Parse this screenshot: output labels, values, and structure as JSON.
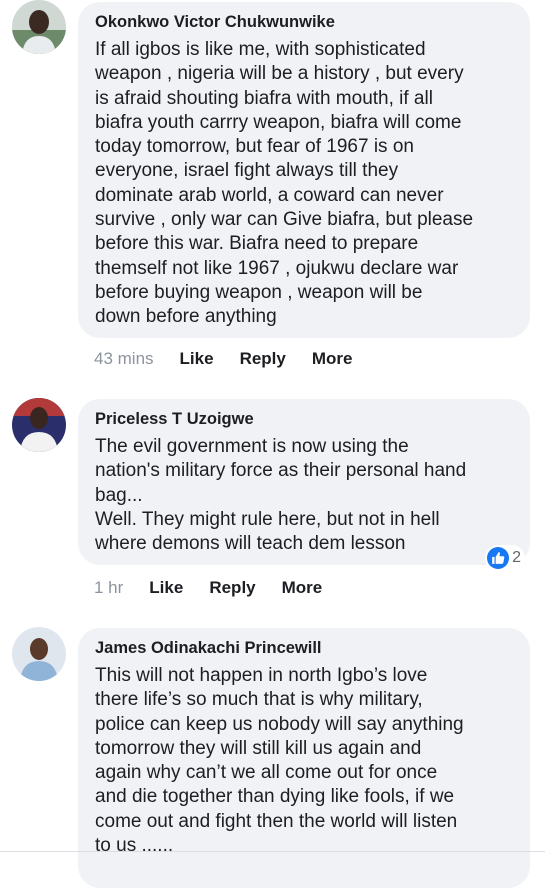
{
  "comments": [
    {
      "author": "Okonkwo Victor Chukwunwike",
      "text": "If all igbos is like me, with sophisticated\nweapon , nigeria will be a history , but every\nis afraid shouting biafra with mouth, if all\nbiafra youth carrry weapon, biafra will come\ntoday tomorrow, but fear of 1967 is on\neveryone, israel fight always till they\ndominate arab world, a coward can never\nsurvive , only war can Give biafra, but please\nbefore this war. Biafra need to prepare\nthemself not like 1967 , ojukwu declare war\nbefore buying weapon , weapon will be\ndown before anything",
      "time": "43 mins",
      "like": "Like",
      "reply": "Reply",
      "more": "More"
    },
    {
      "author": "Priceless T Uzoigwe",
      "text": "The evil government is now using the\nnation's military force as their personal hand\nbag...\nWell. They might rule here, but not in hell\nwhere demons will teach dem lesson",
      "time": "1 hr",
      "like": "Like",
      "reply": "Reply",
      "more": "More",
      "reaction_count": "2",
      "reaction_icon": "thumbs-up-icon"
    },
    {
      "author": "James Odinakachi Princewill",
      "text": "This will not happen in north Igbo’s love\nthere life’s so much that is why military,\npolice can keep us nobody will say anything\ntomorrow they will still kill us again and\nagain why can’t we all come out for once\nand die together than dying like fools, if we\ncome out and fight then the world will listen\nto us ......"
    }
  ],
  "colors": {
    "bubble": "#f0f2f5",
    "time": "#8d949e",
    "like_badge": "#1877f2"
  }
}
